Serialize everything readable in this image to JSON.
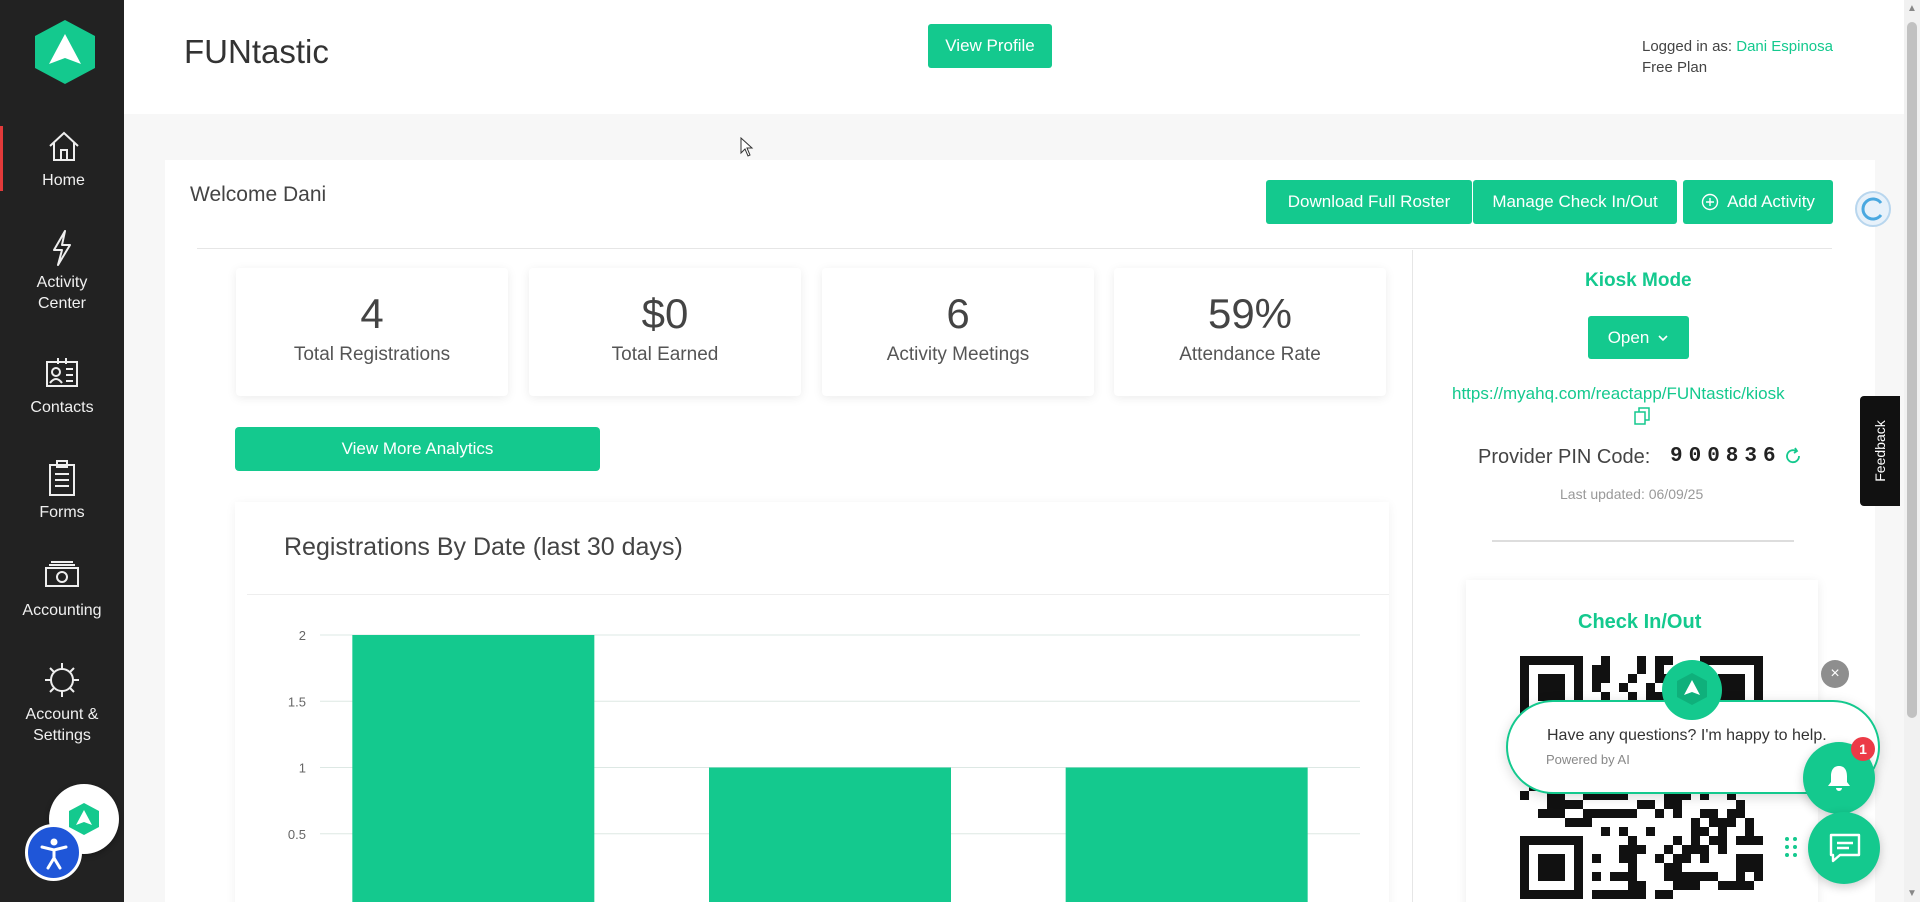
{
  "header": {
    "app_title": "FUNtastic",
    "view_profile_label": "View Profile",
    "logged_in_prefix": "Logged in as: ",
    "user_name": "Dani Espinosa",
    "plan": "Free Plan"
  },
  "sidebar": {
    "items": [
      {
        "label": "Home",
        "icon": "home-icon"
      },
      {
        "label": "Activity Center",
        "icon": "lightning-icon"
      },
      {
        "label": "Contacts",
        "icon": "contact-card-icon"
      },
      {
        "label": "Forms",
        "icon": "clipboard-icon"
      },
      {
        "label": "Accounting",
        "icon": "money-icon"
      },
      {
        "label": "Account & Settings",
        "icon": "gear-icon"
      }
    ],
    "active": "Home"
  },
  "main": {
    "welcome": "Welcome Dani",
    "buttons": {
      "download_roster": "Download Full Roster",
      "manage_checkin": "Manage Check In/Out",
      "add_activity": "Add Activity"
    },
    "stats": [
      {
        "value": "4",
        "label": "Total Registrations"
      },
      {
        "value": "$0",
        "label": "Total Earned"
      },
      {
        "value": "6",
        "label": "Activity Meetings"
      },
      {
        "value": "59%",
        "label": "Attendance Rate"
      }
    ],
    "analytics_button": "View More Analytics",
    "chart_title": "Registrations By Date (last 30 days)"
  },
  "chart_data": {
    "type": "bar",
    "title": "Registrations By Date (last 30 days)",
    "categories": [
      "",
      "",
      ""
    ],
    "values": [
      2,
      1,
      1
    ],
    "ylim": [
      0,
      2
    ],
    "yticks": [
      "2",
      "1.5",
      "1",
      "0.5"
    ],
    "grid": true,
    "color": "#14c98e"
  },
  "right_panel": {
    "kiosk_title": "Kiosk Mode",
    "open_label": "Open",
    "kiosk_url": "https://myahq.com/reactapp/FUNtastic/kiosk",
    "pin_label": "Provider PIN Code:",
    "pin_code": "900836",
    "last_updated": "Last updated: 06/09/25",
    "checkin_title": "Check In/Out"
  },
  "feedback_label": "Feedback",
  "chat": {
    "message": "Have any questions? I'm happy to help.",
    "powered_by": "Powered by AI",
    "badge_count": "1"
  },
  "colors": {
    "accent": "#14c98e",
    "sidebar_bg": "#222222",
    "badge": "#ec3b47"
  }
}
